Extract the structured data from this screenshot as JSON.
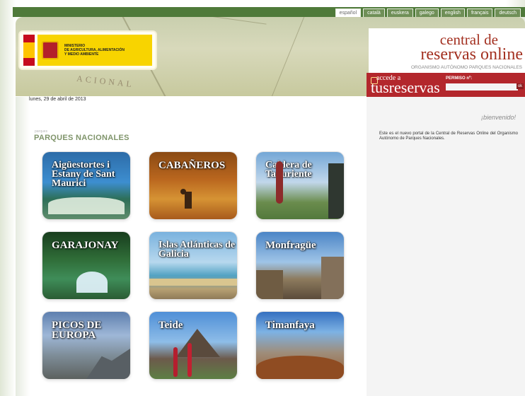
{
  "languages": [
    "español",
    "català",
    "euskera",
    "galego",
    "english",
    "français",
    "deutsch"
  ],
  "header": {
    "ministry": [
      "MINISTERIO",
      "DE AGRICULTURA, ALIMENTACIÓN",
      "Y MEDIO AMBIENTE"
    ],
    "brand_line_1": "central de",
    "brand_line_2": "reservas online",
    "brand_subtitle": "ORGANISMO AUTÓNOMO PARQUES NACIONALES",
    "map_text": "ACIONAL"
  },
  "login": {
    "accede": "accede a",
    "tusreservas": "tusreservas",
    "permiso_label": "PERMISO nº:",
    "go_label": "ok"
  },
  "date": "lunes, 29 de abril de 2013",
  "section": {
    "kicker": "parques",
    "title": "PARQUES NACIONALES"
  },
  "parks": [
    {
      "name": "Aigüestortes i Estany de Sant Maurici"
    },
    {
      "name": "CABAÑEROS"
    },
    {
      "name": "Caldera de Taburiente"
    },
    {
      "name": "GARAJONAY"
    },
    {
      "name": "Islas Atlánticas de Galicia"
    },
    {
      "name": "Monfragüe"
    },
    {
      "name": "PICOS DE EUROPA"
    },
    {
      "name": "Teide"
    },
    {
      "name": "Timanfaya"
    }
  ],
  "sidebar": {
    "welcome": "¡bienvenido!",
    "intro": "Este es el nuevo portal de la Central de Reservas Online del Organismo Autónomo de Parques Nacionales."
  }
}
